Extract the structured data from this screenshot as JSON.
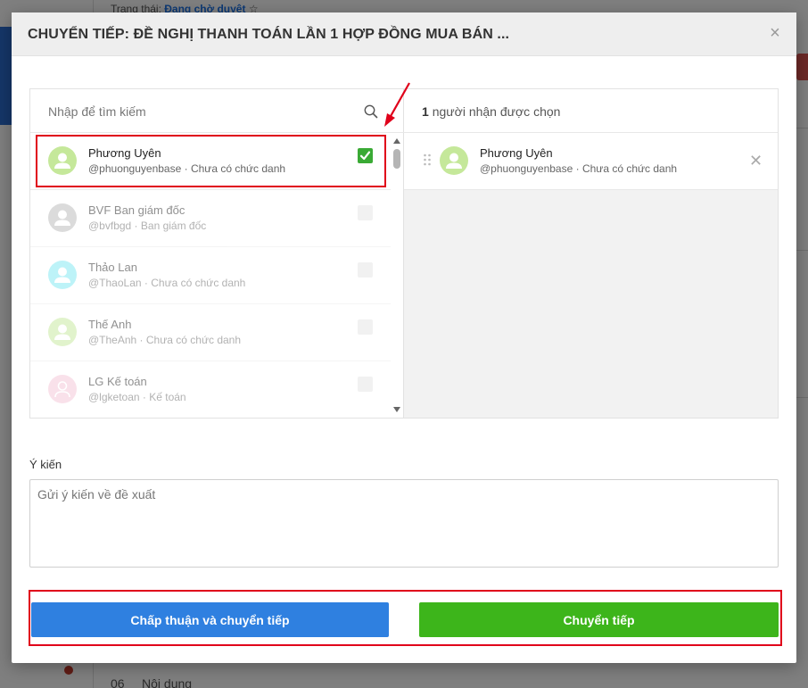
{
  "background": {
    "status_label": "Trạng thái:",
    "status_value": "Đang chờ duyệt",
    "star_icon": "☆",
    "bottom_number": "06",
    "bottom_text": "Nội dung"
  },
  "modal": {
    "title": "CHUYỂN TIẾP: ĐỀ NGHỊ THANH TOÁN LẦN 1 HỢP ĐỒNG MUA BÁN ...",
    "close_icon": "×"
  },
  "search": {
    "placeholder": "Nhập để tìm kiếm"
  },
  "recipients": [
    {
      "name": "Phương Uyên",
      "handle": "@phuonguyenbase",
      "role": "Chưa có chức danh",
      "avatar_color": "#c5e89a",
      "checked": true
    },
    {
      "name": "BVF Ban giám đốc",
      "handle": "@bvfbgd",
      "role": "Ban giám đốc",
      "avatar_color": "#b9b9b9",
      "checked": false
    },
    {
      "name": "Thảo Lan",
      "handle": "@ThaoLan",
      "role": "Chưa có chức danh",
      "avatar_color": "#7ee8f2",
      "checked": false
    },
    {
      "name": "Thế Anh",
      "handle": "@TheAnh",
      "role": "Chưa có chức danh",
      "avatar_color": "#c5e89a",
      "checked": false
    },
    {
      "name": "LG Kế toán",
      "handle": "@lgketoan",
      "role": "Kế toán",
      "avatar_color": "#f5c4d6",
      "checked": false
    }
  ],
  "selected": {
    "count": "1",
    "count_suffix": "người nhận được chọn",
    "items": [
      {
        "name": "Phương Uyên",
        "handle": "@phuonguyenbase",
        "role": "Chưa có chức danh",
        "avatar_color": "#c5e89a"
      }
    ],
    "remove_icon": "✕"
  },
  "comment": {
    "label": "Ý kiến",
    "placeholder": "Gửi ý kiến về đề xuất"
  },
  "buttons": {
    "approve_forward": "Chấp thuận và chuyển tiếp",
    "forward": "Chuyển tiếp"
  },
  "colors": {
    "approve_button": "#2f80e0",
    "forward_button": "#3db51b",
    "checkbox_checked": "#3aaa35",
    "annotation": "#e0001a"
  }
}
